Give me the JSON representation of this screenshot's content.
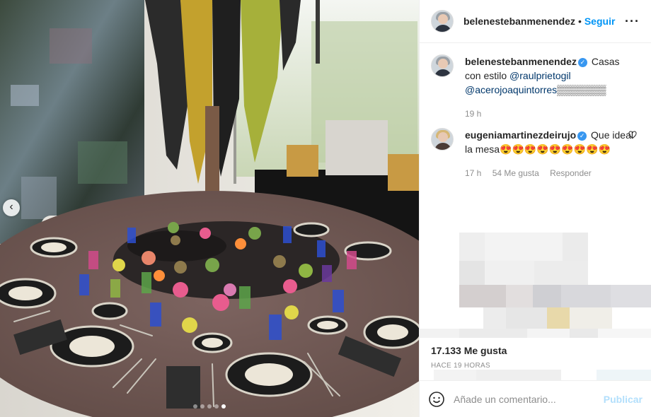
{
  "post": {
    "author": "belenestebanmenendez",
    "separator": "•",
    "follow_label": "Seguir",
    "more_label": "···",
    "caption_text": " Casas con estilo ",
    "caption_mention_1": "@raulprietogil",
    "caption_mention_2": "@acerojoaquintorres",
    "caption_redacted": "▒▒▒▒▒▒▒",
    "caption_time": "19 h"
  },
  "comments": [
    {
      "user": "eugeniamartinezdeirujo",
      "text": " Que ideal la mesa😍😍😍😍😍😍😍😍😍",
      "time": "17 h",
      "likes": "54 Me gusta",
      "reply_label": "Responder"
    }
  ],
  "stats": {
    "likes": "17.133 Me gusta",
    "time_ago": "HACE 19 HORAS"
  },
  "composer": {
    "placeholder": "Añade un comentario...",
    "publish_label": "Publicar"
  },
  "icons": {
    "verified": "verified-badge-icon",
    "heart": "heart-icon",
    "smiley": "emoji-icon",
    "prev": "chevron-left-icon"
  },
  "colors": {
    "link_blue": "#0095f6",
    "mention_blue": "#00376b",
    "muted": "#8e8e8e",
    "publish_disabled": "#b2dffc"
  },
  "carousel": {
    "slide_count": 5,
    "active_slide": 5
  }
}
